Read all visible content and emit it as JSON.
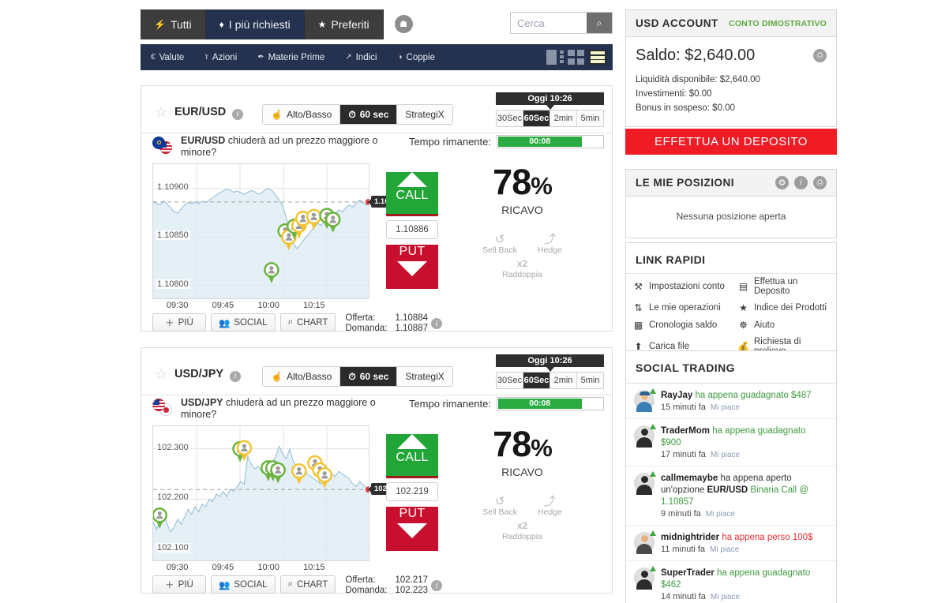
{
  "topbar": {
    "tabs": [
      {
        "label": "Tutti",
        "icon": "bolt-icon",
        "glyph": "⚡",
        "active": false
      },
      {
        "label": "I più richiesti",
        "icon": "flame-icon",
        "glyph": "♦",
        "active": true
      },
      {
        "label": "Preferiti",
        "icon": "star-icon",
        "glyph": "★",
        "active": false
      }
    ],
    "camera_button": {
      "icon": "camera-icon",
      "glyph": "☗"
    },
    "search": {
      "placeholder": "Cerca",
      "value": "",
      "icon": "search-icon",
      "glyph": "⌕"
    }
  },
  "navbar": {
    "items": [
      {
        "label": "Valute",
        "icon": "currency-icon",
        "glyph": "€"
      },
      {
        "label": "Azioni",
        "icon": "stocks-icon",
        "glyph": "ᴛ"
      },
      {
        "label": "Materie Prime",
        "icon": "commodities-icon",
        "glyph": "✒"
      },
      {
        "label": "Indici",
        "icon": "indices-icon",
        "glyph": "↗"
      },
      {
        "label": "Coppie",
        "icon": "pairs-icon",
        "glyph": "◑"
      }
    ],
    "view_modes": [
      {
        "name": "list-detail-view",
        "active": false
      },
      {
        "name": "grid-view",
        "active": false
      },
      {
        "name": "rows-view",
        "active": true
      }
    ]
  },
  "cards": [
    {
      "symbol": "EUR/USD",
      "flags": "eu-us",
      "type_buttons": [
        {
          "label": "Alto/Basso",
          "icon": "thumbs-icon",
          "glyph": "☝",
          "active": false
        },
        {
          "label": "60 sec",
          "icon": "stopwatch-icon",
          "glyph": "⏱",
          "active": true
        },
        {
          "label": "StrategiX",
          "icon": "",
          "glyph": "",
          "active": false
        }
      ],
      "tooltip": "Oggi 10:26",
      "durations": [
        {
          "label": "30Sec",
          "active": false
        },
        {
          "label": "60Sec",
          "active": true
        },
        {
          "label": "2min",
          "active": false
        },
        {
          "label": "5min",
          "active": false
        }
      ],
      "question_prefix": "EUR/USD",
      "question": " chiuderà ad un prezzo maggiore o minore?",
      "tempo_label": "Tempo rimanente:",
      "tempo_value": "00:08",
      "tempo_pct": 80,
      "current_price_pin": "1.10886",
      "call_label": "CALL",
      "put_label": "PUT",
      "strike_price": "1.10886",
      "payout_pct": "78",
      "payout_suffix": "%",
      "payout_label": "RICAVO",
      "extras": [
        {
          "label": "Sell Back",
          "icon": "sellback-icon",
          "glyph": "↺"
        },
        {
          "label": "Hedge",
          "icon": "hedge-icon",
          "glyph": "⤴"
        },
        {
          "label": "Raddoppia",
          "icon": "double-icon",
          "glyph": "x2"
        }
      ],
      "actions": [
        {
          "label": "PIÙ",
          "icon": "plus-icon",
          "glyph": "＋"
        },
        {
          "label": "SOCIAL",
          "icon": "people-icon",
          "glyph": "👥"
        },
        {
          "label": "CHART",
          "icon": "magnifier-icon",
          "glyph": "⌕"
        }
      ],
      "bid_label": "Offerta:",
      "bid_value": "1.10884",
      "ask_label": "Domanda:",
      "ask_value": "1.10887"
    },
    {
      "symbol": "USD/JPY",
      "flags": "us-jp",
      "type_buttons": [
        {
          "label": "Alto/Basso",
          "icon": "thumbs-icon",
          "glyph": "☝",
          "active": false
        },
        {
          "label": "60 sec",
          "icon": "stopwatch-icon",
          "glyph": "⏱",
          "active": true
        },
        {
          "label": "StrategiX",
          "icon": "",
          "glyph": "",
          "active": false
        }
      ],
      "tooltip": "Oggi 10:26",
      "durations": [
        {
          "label": "30Sec",
          "active": false
        },
        {
          "label": "60Sec",
          "active": true
        },
        {
          "label": "2min",
          "active": false
        },
        {
          "label": "5min",
          "active": false
        }
      ],
      "question_prefix": "USD/JPY",
      "question": " chiuderà ad un prezzo maggiore o minore?",
      "tempo_label": "Tempo rimanente:",
      "tempo_value": "00:08",
      "tempo_pct": 80,
      "current_price_pin": "102.219",
      "call_label": "CALL",
      "put_label": "PUT",
      "strike_price": "102.219",
      "payout_pct": "78",
      "payout_suffix": "%",
      "payout_label": "RICAVO",
      "extras": [
        {
          "label": "Sell Back",
          "icon": "sellback-icon",
          "glyph": "↺"
        },
        {
          "label": "Hedge",
          "icon": "hedge-icon",
          "glyph": "⤴"
        },
        {
          "label": "Raddoppia",
          "icon": "double-icon",
          "glyph": "x2"
        }
      ],
      "actions": [
        {
          "label": "PIÙ",
          "icon": "plus-icon",
          "glyph": "＋"
        },
        {
          "label": "SOCIAL",
          "icon": "people-icon",
          "glyph": "👥"
        },
        {
          "label": "CHART",
          "icon": "magnifier-icon",
          "glyph": "⌕"
        }
      ],
      "bid_label": "Offerta:",
      "bid_value": "102.217",
      "ask_label": "Domanda:",
      "ask_value": "102.223"
    }
  ],
  "chart_data": [
    {
      "type": "area",
      "title": "EUR/USD",
      "xlabel": "",
      "ylabel": "",
      "x_ticks": [
        "09:30",
        "09:45",
        "10:00",
        "10:15"
      ],
      "y_ticks": [
        "1.10800",
        "1.10850",
        "1.10900"
      ],
      "ylim": [
        1.10785,
        1.10925
      ],
      "grid": true,
      "current_value": 1.10886,
      "reference_line": 1.10886,
      "values": [
        1.10886,
        1.108845,
        1.10883,
        1.10887,
        1.10884,
        1.1088,
        1.10876,
        1.108745,
        1.10879,
        1.10883,
        1.108855,
        1.108845,
        1.10886,
        1.10884,
        1.10887,
        1.108855,
        1.10888,
        1.108905,
        1.10893,
        1.108955,
        1.108975,
        1.10899,
        1.108985,
        1.10896,
        1.108975,
        1.108955,
        1.10894,
        1.10896,
        1.10898,
        1.108965,
        1.10894,
        1.108955,
        1.108985,
        1.109,
        1.108975,
        1.10893,
        1.10888,
        1.10882,
        1.1087,
        1.10856,
        1.10844,
        1.10838,
        1.10842,
        1.10847,
        1.10851,
        1.10856,
        1.1086,
        1.10864,
        1.10862,
        1.10867,
        1.10871,
        1.10869,
        1.10874,
        1.10878,
        1.10876,
        1.1088,
        1.10883,
        1.10881,
        1.10885,
        1.10888,
        1.108855,
        1.10883,
        1.10886
      ],
      "markers": [
        {
          "x": 0.545,
          "y": 1.10816,
          "ring": "green"
        },
        {
          "x": 0.608,
          "y": 1.10856,
          "ring": "green"
        },
        {
          "x": 0.625,
          "y": 1.1085,
          "ring": "yellow"
        },
        {
          "x": 0.65,
          "y": 1.10861,
          "ring": "green"
        },
        {
          "x": 0.672,
          "y": 1.10862,
          "ring": "yellow"
        },
        {
          "x": 0.69,
          "y": 1.10869,
          "ring": "yellow"
        },
        {
          "x": 0.74,
          "y": 1.10871,
          "ring": "yellow"
        },
        {
          "x": 0.8,
          "y": 1.10872,
          "ring": "green"
        },
        {
          "x": 0.828,
          "y": 1.10868,
          "ring": "green"
        }
      ]
    },
    {
      "type": "area",
      "title": "USD/JPY",
      "xlabel": "",
      "ylabel": "",
      "x_ticks": [
        "09:30",
        "09:45",
        "10:00",
        "10:15"
      ],
      "y_ticks": [
        "102.100",
        "102.200",
        "102.300"
      ],
      "ylim": [
        102.075,
        102.345
      ],
      "grid": true,
      "current_value": 102.219,
      "reference_line": 102.219,
      "values": [
        102.155,
        102.14,
        102.16,
        102.175,
        102.15,
        102.135,
        102.145,
        102.16,
        102.15,
        102.165,
        102.18,
        102.17,
        102.185,
        102.175,
        102.19,
        102.185,
        102.2,
        102.195,
        102.21,
        102.205,
        102.215,
        102.205,
        102.22,
        102.215,
        102.225,
        102.235,
        102.23,
        102.285,
        102.27,
        102.26,
        102.265,
        102.255,
        102.265,
        102.275,
        102.27,
        102.285,
        102.305,
        102.29,
        102.28,
        102.3,
        102.275,
        102.265,
        102.255,
        102.26,
        102.25,
        102.245,
        102.24,
        102.235,
        102.23,
        102.24,
        102.26,
        102.25,
        102.245,
        102.255,
        102.25,
        102.245,
        102.24,
        102.23,
        102.225,
        102.235,
        102.228,
        102.222,
        102.219
      ],
      "markers": [
        {
          "x": 0.03,
          "y": 102.168,
          "ring": "green"
        },
        {
          "x": 0.4,
          "y": 102.3,
          "ring": "green"
        },
        {
          "x": 0.42,
          "y": 102.302,
          "ring": "yellow"
        },
        {
          "x": 0.53,
          "y": 102.262,
          "ring": "green"
        },
        {
          "x": 0.552,
          "y": 102.262,
          "ring": "green"
        },
        {
          "x": 0.575,
          "y": 102.258,
          "ring": "green"
        },
        {
          "x": 0.672,
          "y": 102.256,
          "ring": "yellow"
        },
        {
          "x": 0.745,
          "y": 102.272,
          "ring": "yellow"
        },
        {
          "x": 0.768,
          "y": 102.258,
          "ring": "yellow"
        },
        {
          "x": 0.79,
          "y": 102.248,
          "ring": "yellow"
        }
      ]
    }
  ],
  "sidebar": {
    "account": {
      "title": "USD ACCOUNT",
      "demo_badge": "CONTO DIMOSTRATIVO",
      "balance": "Saldo: $2,640.00",
      "lines": [
        "Liquidità disponibile: $2,640.00",
        "Investimenti: $0.00",
        "Bonus in sospeso: $0.00"
      ],
      "print_icon": "print-icon"
    },
    "deposit_button": "EFFETTUA UN DEPOSITO",
    "positions": {
      "title": "LE MIE POSIZIONI",
      "empty": "Nessuna posizione aperta",
      "icons": [
        "gear-icon",
        "info-icon",
        "print-icon"
      ]
    },
    "quick_links": {
      "title": "LINK RAPIDI",
      "items": [
        {
          "label": "Impostazioni conto",
          "icon": "tools-icon",
          "glyph": "⚒",
          "color": "#6b6b6b"
        },
        {
          "label": "Effettua un Deposito",
          "icon": "card-icon",
          "glyph": "▤",
          "color": "#4a90c2"
        },
        {
          "label": "Le mie operazioni",
          "icon": "exchange-icon",
          "glyph": "⇅",
          "color": "#d4a017"
        },
        {
          "label": "Indice dei Prodotti",
          "icon": "star-icon",
          "glyph": "★",
          "color": "#f0c419"
        },
        {
          "label": "Cronologia saldo",
          "icon": "calendar-icon",
          "glyph": "▦",
          "color": "#5fa83f"
        },
        {
          "label": "Aiuto",
          "icon": "lifering-icon",
          "glyph": "☸",
          "color": "#e8603c"
        },
        {
          "label": "Carica file",
          "icon": "upload-icon",
          "glyph": "⬆",
          "color": "#3fa63f"
        },
        {
          "label": "Richiesta di prelievo",
          "icon": "moneybag-icon",
          "glyph": "💰",
          "color": "#3d7fbd"
        }
      ]
    },
    "social": {
      "title": "SOCIAL TRADING",
      "like_label": "Mi piace",
      "items": [
        {
          "avatar": "worker",
          "user": "RayJay",
          "action": " ha appena guadagnato $487",
          "action_type": "win",
          "time": "15 minuti fa"
        },
        {
          "avatar": "plain",
          "user": "TraderMom",
          "action": " ha appena guadagnato $900",
          "action_type": "win",
          "time": "17 minuti fa"
        },
        {
          "avatar": "plain",
          "user": "callmemaybe",
          "action": " ha appena aperto un'opzione ",
          "action_type": "open",
          "pair": "EUR/USD",
          "action_tail": " Binaria Call @ 1.10857",
          "time": "9 minuti fa"
        },
        {
          "avatar": "suit",
          "user": "midnightrider",
          "action": " ha appena perso 100$",
          "action_type": "lose",
          "time": "11 minuti fa"
        },
        {
          "avatar": "plain",
          "user": "SuperTrader",
          "action": " ha appena guadagnato $462",
          "action_type": "win",
          "time": "14 minuti fa"
        }
      ]
    }
  }
}
